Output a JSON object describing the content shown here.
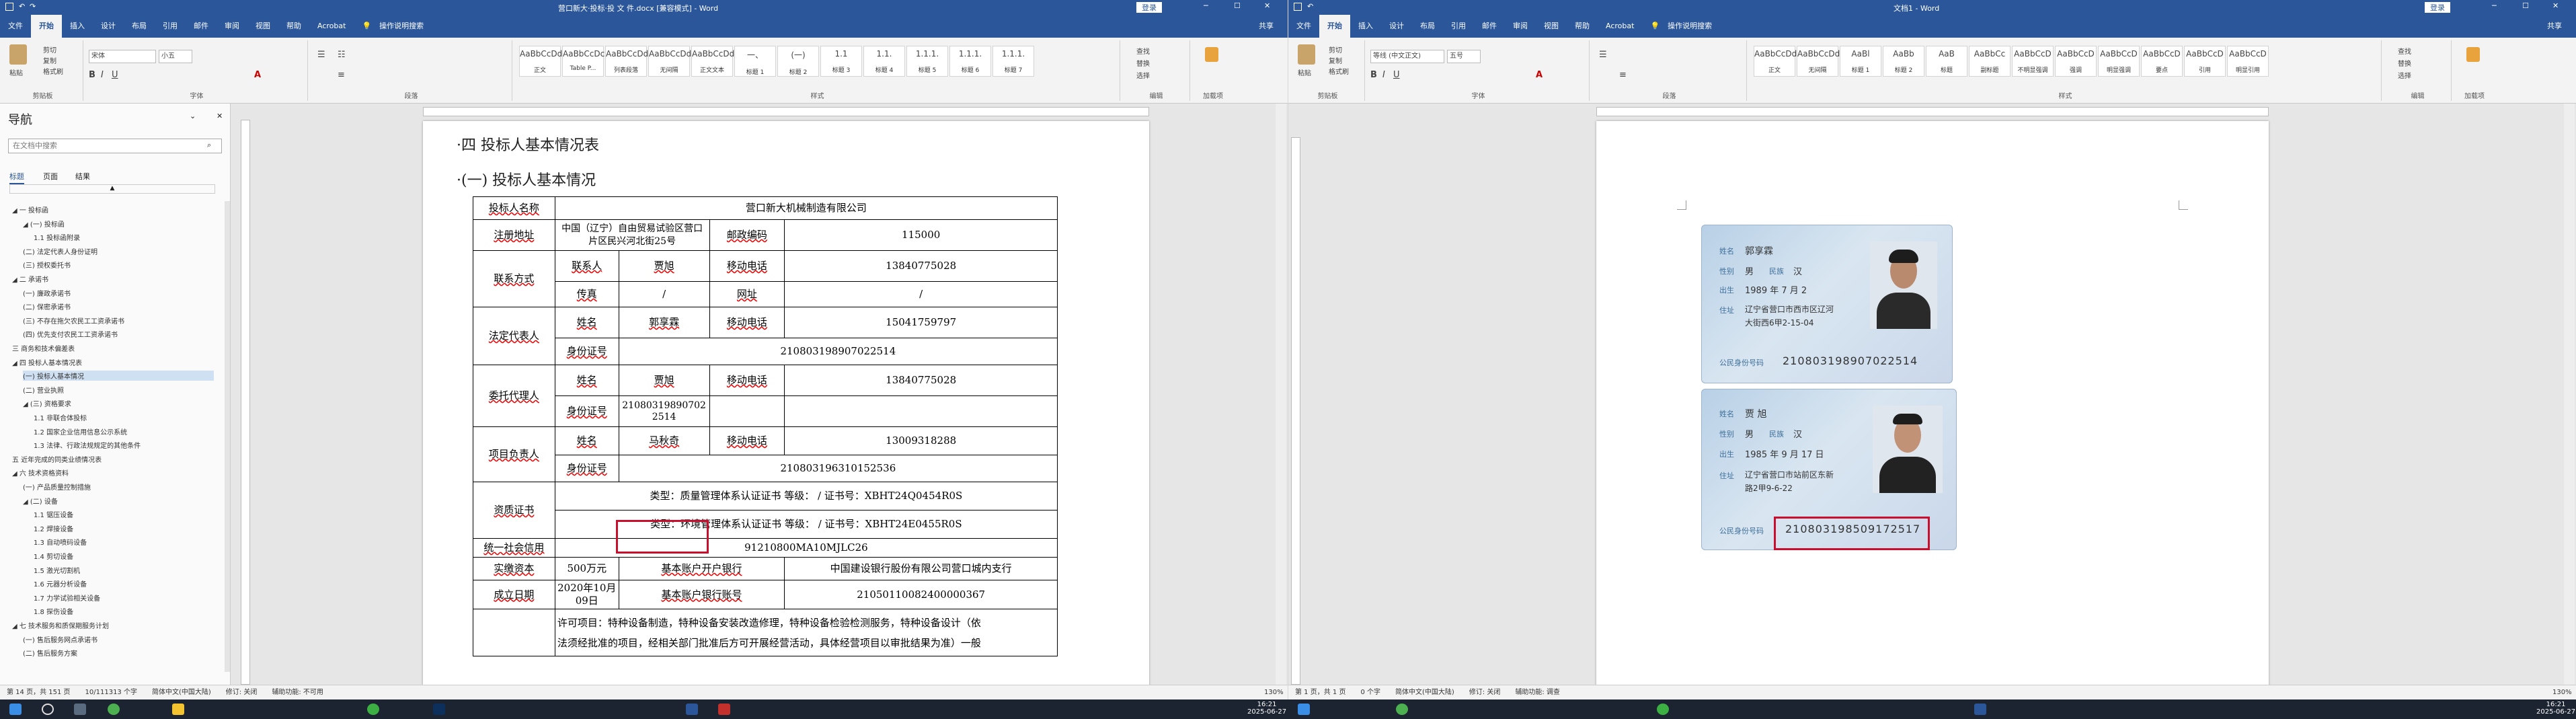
{
  "left_window": {
    "title": "营口新大·投标·投 文 件.docx [兼容模式] - Word",
    "tabs": [
      "文件",
      "开始",
      "插入",
      "设计",
      "布局",
      "引用",
      "邮件",
      "审阅",
      "视图",
      "帮助",
      "Acrobat"
    ],
    "tell_me": "操作说明搜索",
    "user": "登录",
    "share": "共享",
    "ribbon": {
      "clipboard": {
        "paste": "粘贴",
        "cut": "剪切",
        "copy": "复制",
        "format_painter": "格式刷",
        "label": "剪贴板"
      },
      "font": {
        "name": "宋体",
        "size": "小五",
        "label": "字体"
      },
      "paragraph": {
        "label": "段落"
      },
      "styles": {
        "items": [
          {
            "preview": "AaBbCcDd",
            "name": "正文"
          },
          {
            "preview": "AaBbCcDc",
            "name": "Table P..."
          },
          {
            "preview": "AaBbCcDd",
            "name": "列表段落"
          },
          {
            "preview": "AaBbCcDd",
            "name": "无间隔"
          },
          {
            "preview": "AaBbCcDd",
            "name": "正文文本"
          },
          {
            "preview": "一、",
            "name": "标题 1"
          },
          {
            "preview": "(一)",
            "name": "标题 2"
          },
          {
            "preview": "1.1",
            "name": "标题 3"
          },
          {
            "preview": "1.1.",
            "name": "标题 4"
          },
          {
            "preview": "1.1.1.",
            "name": "标题 5"
          },
          {
            "preview": "1.1.1.",
            "name": "标题 6"
          },
          {
            "preview": "1.1.1.",
            "name": "标题 7"
          }
        ],
        "label": "样式"
      },
      "editing": {
        "find": "查找",
        "replace": "替换",
        "select": "选择",
        "label": "编辑"
      },
      "addins": {
        "label": "加载项"
      }
    },
    "nav": {
      "title": "导航",
      "search_placeholder": "在文档中搜索",
      "tabs": [
        "标题",
        "页面",
        "结果"
      ],
      "items": [
        {
          "t": "◢ 一 投标函",
          "d": 0
        },
        {
          "t": "◢ (一) 投标函",
          "d": 1
        },
        {
          "t": "1.1 投标函附录",
          "d": 2
        },
        {
          "t": "(二) 法定代表人身份证明",
          "d": 1
        },
        {
          "t": "(三) 授权委托书",
          "d": 1
        },
        {
          "t": "◢ 二 承诺书",
          "d": 0
        },
        {
          "t": "(一) 廉政承诺书",
          "d": 1
        },
        {
          "t": "(二) 保密承诺书",
          "d": 1
        },
        {
          "t": "(三) 不存在拖欠农民工工资承诺书",
          "d": 1
        },
        {
          "t": "(四) 优先支付农民工工资承诺书",
          "d": 1
        },
        {
          "t": "三 商务和技术偏差表",
          "d": 0
        },
        {
          "t": "◢ 四 投标人基本情况表",
          "d": 0
        },
        {
          "t": "(一) 投标人基本情况",
          "d": 1
        },
        {
          "t": "(二) 营业执照",
          "d": 1
        },
        {
          "t": "◢ (三) 资格要求",
          "d": 1
        },
        {
          "t": "1.1 非联合体投标",
          "d": 2
        },
        {
          "t": "1.2 国家企业信用信息公示系统",
          "d": 2
        },
        {
          "t": "1.3 法律、行政法规规定的其他条件",
          "d": 2
        },
        {
          "t": "五 近年完成的同类业绩情况表",
          "d": 0
        },
        {
          "t": "◢ 六 技术资格资料",
          "d": 0
        },
        {
          "t": "(一) 产品质量控制措施",
          "d": 1
        },
        {
          "t": "◢ (二) 设备",
          "d": 1
        },
        {
          "t": "1.1 锯压设备",
          "d": 2
        },
        {
          "t": "1.2 焊接设备",
          "d": 2
        },
        {
          "t": "1.3 自动喷码设备",
          "d": 2
        },
        {
          "t": "1.4 剪切设备",
          "d": 2
        },
        {
          "t": "1.5 激光切割机",
          "d": 2
        },
        {
          "t": "1.6 元器分析设备",
          "d": 2
        },
        {
          "t": "1.7 力学试验相关设备",
          "d": 2
        },
        {
          "t": "1.8 探伤设备",
          "d": 2
        },
        {
          "t": "◢ 七 技术服务和质保期服务计划",
          "d": 0
        },
        {
          "t": "(一) 售后服务网点承诺书",
          "d": 1
        },
        {
          "t": "(二) 售后服务方案",
          "d": 1
        }
      ],
      "selected_index": 12
    },
    "doc": {
      "heading1": "·四 投标人基本情况表",
      "heading2": "·(一)  投标人基本情况",
      "table": {
        "bidder_name_label": "投标人名称",
        "bidder_name": "营口新大机械制造有限公司",
        "address_label": "注册地址",
        "address": "中国（辽宁）自由贸易试验区营口片区民兴河北街25号",
        "postcode_label": "邮政编码",
        "postcode": "115000",
        "contact_label": "联系方式",
        "contact_person_label": "联系人",
        "contact_person": "贾旭",
        "mobile_label": "移动电话",
        "contact_mobile": "13840775028",
        "fax_label": "传真",
        "fax": "/",
        "website_label": "网址",
        "website": "/",
        "legal_rep_label": "法定代表人",
        "name_label": "姓名",
        "legal_name": "郭享霖",
        "legal_mobile": "15041759797",
        "id_label": "身份证号",
        "legal_id": "210803198907022514",
        "agent_label": "委托代理人",
        "agent_name": "贾旭",
        "agent_mobile": "13840775028",
        "agent_id": "210803198907022514",
        "pm_label": "项目负责人",
        "pm_name": "马秋奇",
        "pm_mobile": "13009318288",
        "pm_id": "210803196310152536",
        "cert_label": "资质证书",
        "cert1": "类型：质量管理体系认证证书   等级：   /   证书号：XBHT24Q0454R0S",
        "cert2": "类型：环境管理体系认证证书   等级：   /   证书号：XBHT24E0455R0S",
        "uscc_label": "统一社会信用",
        "uscc": "91210800MA10MJLC26",
        "capital_label": "实缴资本",
        "capital": "500万元",
        "bank_label": "基本账户开户银行",
        "bank": "中国建设银行股份有限公司营口城内支行",
        "founded_label": "成立日期",
        "founded": "2020年10月09日",
        "account_label": "基本账户银行账号",
        "account": "21050110082400000367",
        "scope1": "许可项目：特种设备制造，特种设备安装改造修理，特种设备检验检测服务，特种设备设计（依",
        "scope2": "法须经批准的项目，经相关部门批准后方可开展经营活动，具体经营项目以审批结果为准）一般"
      }
    },
    "status": {
      "page": "第 14 页，共 151 页",
      "words": "10/111313 个字",
      "lang": "简体中文(中国大陆)",
      "track": "修订: 关闭",
      "access": "辅助功能: 不可用",
      "zoom": "130%"
    }
  },
  "right_window": {
    "title": "文档1 - Word",
    "tabs": [
      "文件",
      "开始",
      "插入",
      "设计",
      "布局",
      "引用",
      "邮件",
      "审阅",
      "视图",
      "帮助",
      "Acrobat"
    ],
    "tell_me": "操作说明搜索",
    "user": "登录",
    "share": "共享",
    "font": {
      "name": "等线 (中文正文)",
      "size": "五号"
    },
    "styles": [
      {
        "preview": "AaBbCcDd",
        "name": "正文"
      },
      {
        "preview": "AaBbCcDd",
        "name": "无间隔"
      },
      {
        "preview": "AaBl",
        "name": "标题 1"
      },
      {
        "preview": "AaBb",
        "name": "标题 2"
      },
      {
        "preview": "AaB",
        "name": "标题"
      },
      {
        "preview": "AaBbCc",
        "name": "副标题"
      },
      {
        "preview": "AaBbCcD",
        "name": "不明显强调"
      },
      {
        "preview": "AaBbCcD",
        "name": "强调"
      },
      {
        "preview": "AaBbCcD",
        "name": "明显强调"
      },
      {
        "preview": "AaBbCcD",
        "name": "要点"
      },
      {
        "preview": "AaBbCcD",
        "name": "引用"
      },
      {
        "preview": "AaBbCcD",
        "name": "明显引用"
      }
    ],
    "cards": [
      {
        "name_label": "姓名",
        "name": "郭享霖",
        "sex_label": "性别",
        "sex": "男",
        "ethnic_label": "民族",
        "ethnic": "汉",
        "birth_label": "出生",
        "birth": "1989  年  7  月  2",
        "addr_label": "住址",
        "addr1": "辽宁省营口市西市区辽河",
        "addr2": "大街西6甲2-15-04",
        "id_label": "公民身份号码",
        "id": "210803198907022514"
      },
      {
        "name_label": "姓名",
        "name": "贾  旭",
        "sex_label": "性别",
        "sex": "男",
        "ethnic_label": "民族",
        "ethnic": "汉",
        "birth_label": "出生",
        "birth": "1985  年  9  月  17  日",
        "addr_label": "住址",
        "addr1": "辽宁省营口市站前区东新",
        "addr2": "路2甲9-6-22",
        "id_label": "公民身份号码",
        "id": "210803198509172517"
      }
    ],
    "status": {
      "page": "第 1 页，共 1 页",
      "words": "0 个字",
      "lang": "简体中文(中国大陆)",
      "track": "修订: 关闭",
      "access": "辅助功能: 调查",
      "zoom": "130%"
    }
  },
  "taskbar": {
    "time_left": "16:21",
    "date_left": "2025-06-27",
    "time_right": "16:21",
    "date_right": "2025-06-27"
  }
}
